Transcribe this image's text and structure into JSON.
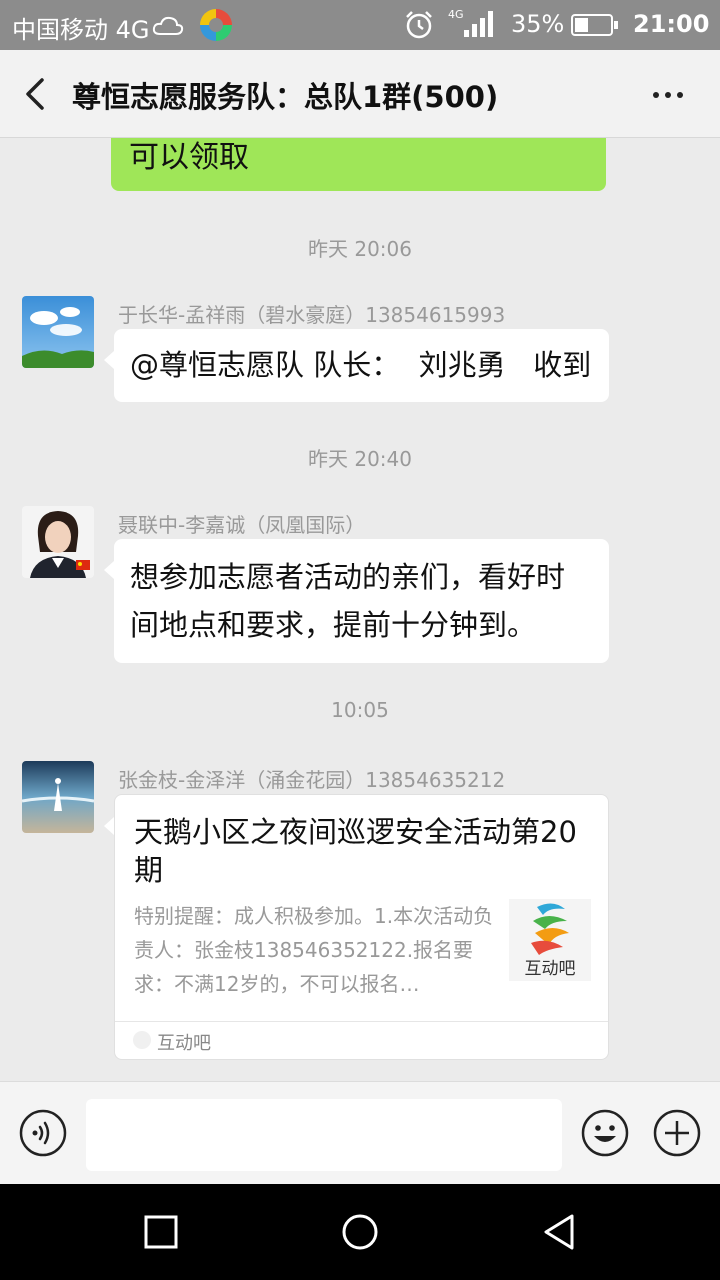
{
  "status_bar": {
    "carrier": "中国移动 4G",
    "battery_pct": "35%",
    "time": "21:00",
    "network_badge": "4G"
  },
  "header": {
    "title": "尊恒志愿服务队：总队1群(500)"
  },
  "messages": {
    "partial_bubble_text": "可以领取",
    "ts1": "昨天 20:06",
    "msg1": {
      "sender": "于长华-孟祥雨（碧水豪庭）13854615993",
      "text": "@尊恒志愿队 队长：  刘兆勇   收到"
    },
    "ts2": "昨天 20:40",
    "msg2": {
      "sender": "聂联中-李嘉诚（凤凰国际）",
      "text": "想参加志愿者活动的亲们，看好时间地点和要求，提前十分钟到。"
    },
    "ts3": "10:05",
    "msg3": {
      "sender": "张金枝-金泽洋（涌金花园）13854635212",
      "card_title": "天鹅小区之夜间巡逻安全活动第20期",
      "card_desc": "特别提醒：成人积极参加。1.本次活动负责人：张金枝138546352122.报名要求：不满12岁的，不可以报名…",
      "card_thumb_label": "互动吧",
      "card_source": "互动吧"
    }
  },
  "input": {
    "placeholder": ""
  },
  "colors": {
    "self_bubble": "#9fe658",
    "chat_bg": "#ebebeb",
    "status_bar": "#8c8c8c"
  }
}
